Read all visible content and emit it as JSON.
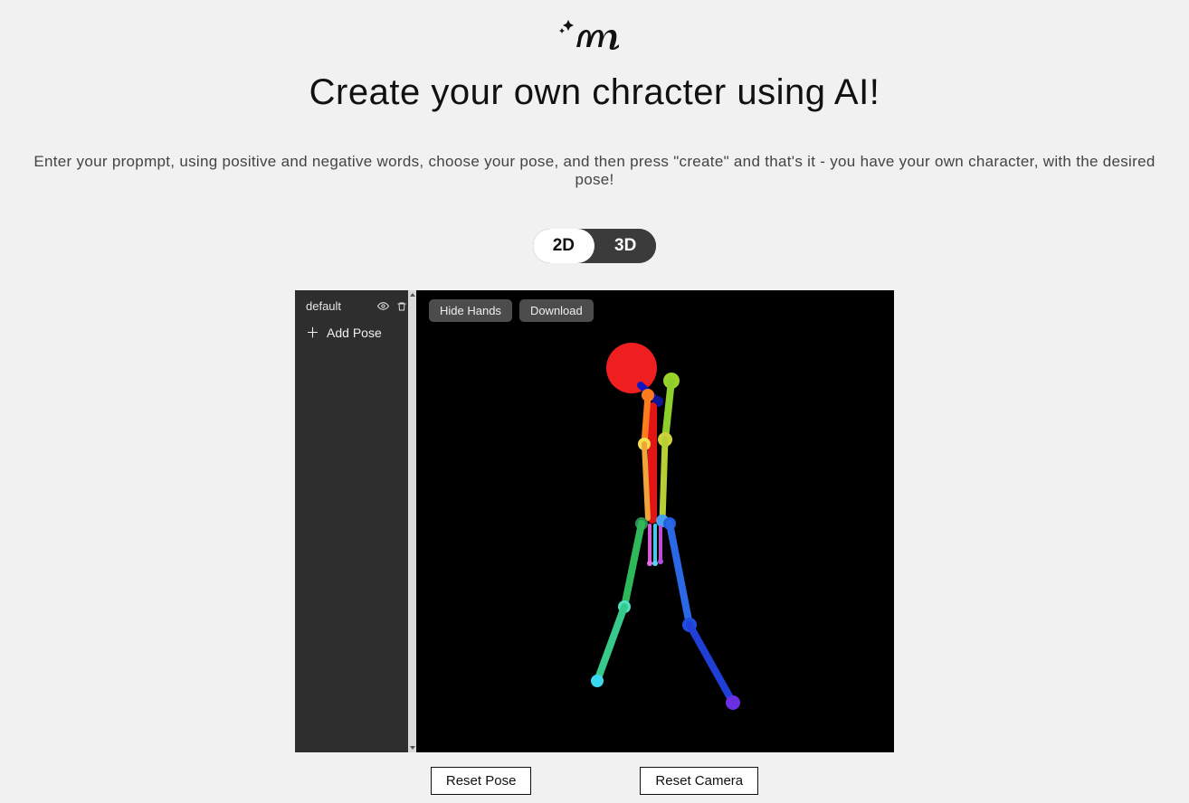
{
  "title": "Create your own chracter using AI!",
  "subtitle": "Enter your propmpt, using positive and negative words, choose your pose, and then press \"create\" and that's it - you have your own character, with the desired pose!",
  "segmented": {
    "option_2d": "2D",
    "option_3d": "3D",
    "active": "2D"
  },
  "sidebar": {
    "pose_name": "default",
    "add_pose_label": "Add Pose"
  },
  "viewport": {
    "hide_hands_label": "Hide Hands",
    "download_label": "Download"
  },
  "buttons": {
    "reset_pose": "Reset Pose",
    "reset_camera": "Reset Camera"
  }
}
